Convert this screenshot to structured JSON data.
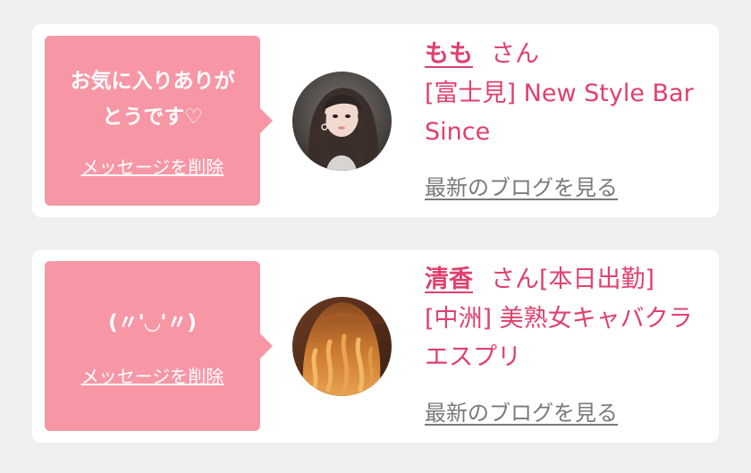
{
  "favorites": [
    {
      "message": "お気に入りありがとうです♡",
      "delete_label": "メッセージを削除",
      "name": "もも",
      "honorific": "さん",
      "status": "",
      "shop": "[富士見] New Style Bar Since",
      "blog_label": "最新のブログを見る",
      "avatar_icon": "profile-photo"
    },
    {
      "message": "(〃'◡'〃)",
      "delete_label": "メッセージを削除",
      "name": "清香",
      "honorific": "さん",
      "status": "[本日出勤]",
      "shop": "[中洲] 美熟女キャバクラ エスプリ",
      "blog_label": "最新のブログを見る",
      "avatar_icon": "profile-photo"
    }
  ],
  "colors": {
    "accent": "#e0406e",
    "bubble": "#f797a6",
    "background": "#efefef",
    "link_gray": "#7a7a7a"
  }
}
